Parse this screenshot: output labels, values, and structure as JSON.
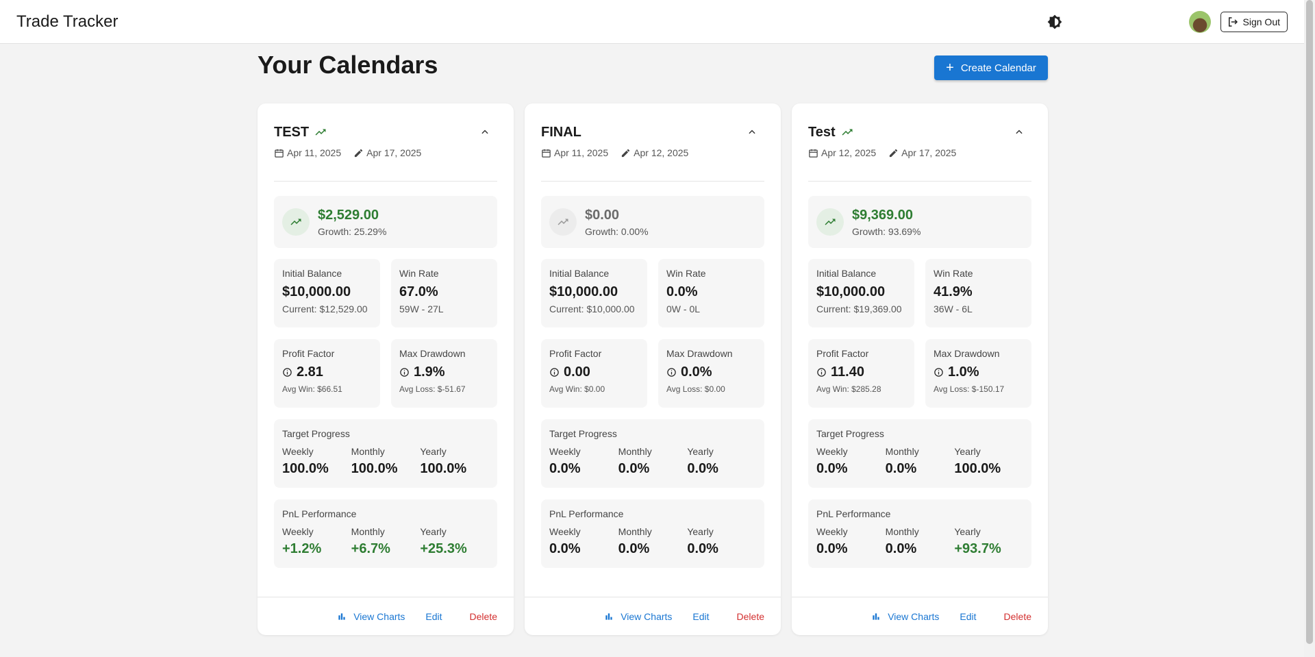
{
  "app": {
    "title": "Trade Tracker",
    "sign_out_label": "Sign Out"
  },
  "page": {
    "title": "Your Calendars",
    "create_label": "Create Calendar"
  },
  "colors": {
    "primary": "#1976d2",
    "positive": "#2e7d32",
    "danger": "#d32f2f"
  },
  "labels": {
    "initial_balance": "Initial Balance",
    "win_rate": "Win Rate",
    "profit_factor": "Profit Factor",
    "max_drawdown": "Max Drawdown",
    "target_progress": "Target Progress",
    "pnl_performance": "PnL Performance",
    "weekly": "Weekly",
    "monthly": "Monthly",
    "yearly": "Yearly",
    "view_charts": "View Charts",
    "edit": "Edit",
    "delete": "Delete"
  },
  "calendars": [
    {
      "name": "TEST",
      "trend": "up",
      "created": "Apr 11, 2025",
      "updated": "Apr 17, 2025",
      "balance": "$2,529.00",
      "growth": "Growth: 25.29%",
      "initial_balance": "$10,000.00",
      "current": "Current: $12,529.00",
      "win_rate": "67.0%",
      "record": "59W - 27L",
      "profit_factor": "2.81",
      "avg_win": "Avg Win: $66.51",
      "max_drawdown": "1.9%",
      "avg_loss": "Avg Loss: $-51.67",
      "target": {
        "weekly": "100.0%",
        "monthly": "100.0%",
        "yearly": "100.0%"
      },
      "pnl": {
        "weekly": "+1.2%",
        "monthly": "+6.7%",
        "yearly": "+25.3%"
      }
    },
    {
      "name": "FINAL",
      "trend": "flat",
      "created": "Apr 11, 2025",
      "updated": "Apr 12, 2025",
      "balance": "$0.00",
      "growth": "Growth: 0.00%",
      "initial_balance": "$10,000.00",
      "current": "Current: $10,000.00",
      "win_rate": "0.0%",
      "record": "0W - 0L",
      "profit_factor": "0.00",
      "avg_win": "Avg Win: $0.00",
      "max_drawdown": "0.0%",
      "avg_loss": "Avg Loss: $0.00",
      "target": {
        "weekly": "0.0%",
        "monthly": "0.0%",
        "yearly": "0.0%"
      },
      "pnl": {
        "weekly": "0.0%",
        "monthly": "0.0%",
        "yearly": "0.0%"
      }
    },
    {
      "name": "Test",
      "trend": "up",
      "created": "Apr 12, 2025",
      "updated": "Apr 17, 2025",
      "balance": "$9,369.00",
      "growth": "Growth: 93.69%",
      "initial_balance": "$10,000.00",
      "current": "Current: $19,369.00",
      "win_rate": "41.9%",
      "record": "36W - 6L",
      "profit_factor": "11.40",
      "avg_win": "Avg Win: $285.28",
      "max_drawdown": "1.0%",
      "avg_loss": "Avg Loss: $-150.17",
      "target": {
        "weekly": "0.0%",
        "monthly": "0.0%",
        "yearly": "100.0%"
      },
      "pnl": {
        "weekly": "0.0%",
        "monthly": "0.0%",
        "yearly": "+93.7%"
      }
    }
  ]
}
